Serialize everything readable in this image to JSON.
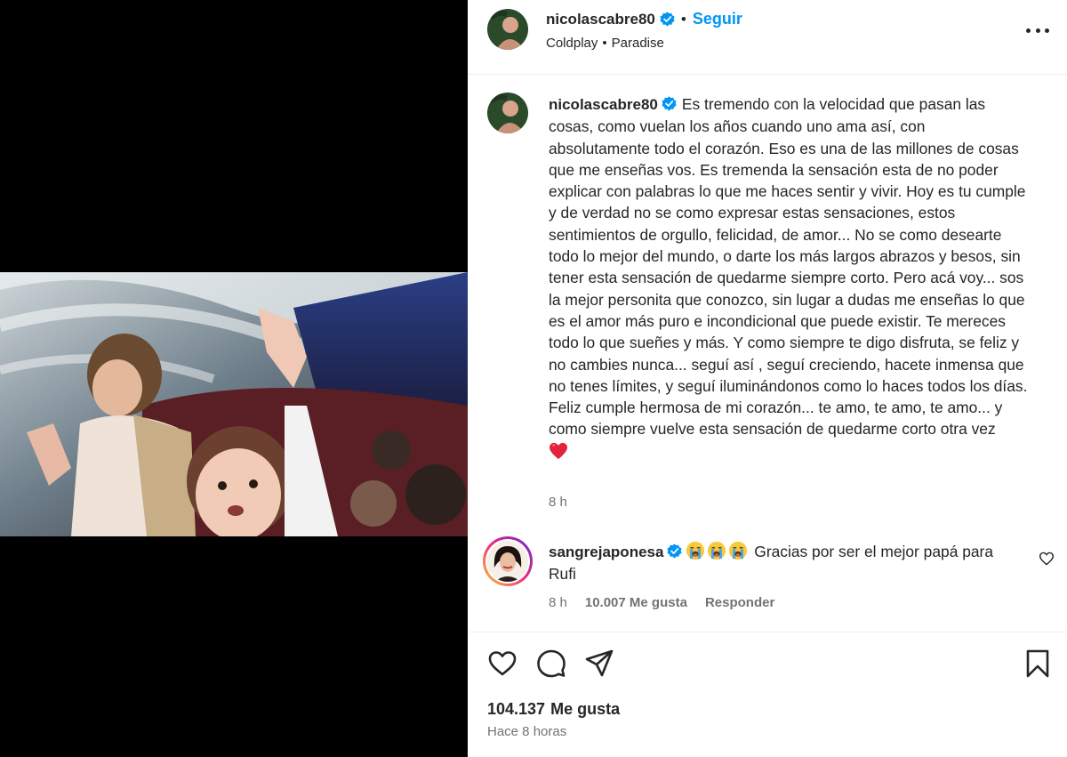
{
  "post": {
    "author": "nicolascabre80",
    "follow_label": "Seguir",
    "music": {
      "artist": "Coldplay",
      "separator": "•",
      "track": "Paradise"
    },
    "caption": "Es tremendo con la velocidad que pasan las cosas, como vuelan los años cuando uno ama así, con absolutamente todo el corazón. Eso es una de las millones de cosas que me enseñas vos. Es tremenda la sensación esta de no poder explicar con palabras lo que me haces sentir y vivir. Hoy es tu cumple y de verdad no se como expresar estas sensaciones, estos sentimientos de orgullo, felicidad, de amor... No se como desearte todo lo mejor del mundo, o darte los más largos abrazos y besos, sin tener esta sensación de quedarme siempre corto. Pero acá voy... sos la mejor personita que conozco, sin lugar a dudas me enseñas lo que es el amor más puro e incondicional que puede existir. Te mereces todo lo que sueñes y más. Y como siempre te digo disfruta, se feliz y no cambies nunca... seguí así , seguí creciendo, hacete inmensa que no tenes límites, y seguí iluminándonos como lo haces todos los días. Feliz cumple hermosa de mi corazón... te amo, te amo, te amo... y como siempre vuelve esta sensación de quedarme corto otra vez",
    "caption_emoji": "red-heart-emoji",
    "caption_time": "8 h",
    "likes_count": "104.137",
    "likes_label": "Me gusta",
    "post_time": "Hace 8 horas"
  },
  "comment": {
    "author": "sangrejaponesa",
    "emojis": [
      "loudly-crying-face-emoji",
      "loudly-crying-face-emoji",
      "loudly-crying-face-emoji"
    ],
    "text": "Gracias por ser el mejor papá para Rufi",
    "time": "8 h",
    "likes_count": "10.007",
    "likes_label": "Me gusta",
    "reply_label": "Responder"
  },
  "colors": {
    "accent": "#0095f6",
    "verified": "#0095f6",
    "text": "#262626",
    "muted": "#737373",
    "heart": "#e0243b"
  }
}
